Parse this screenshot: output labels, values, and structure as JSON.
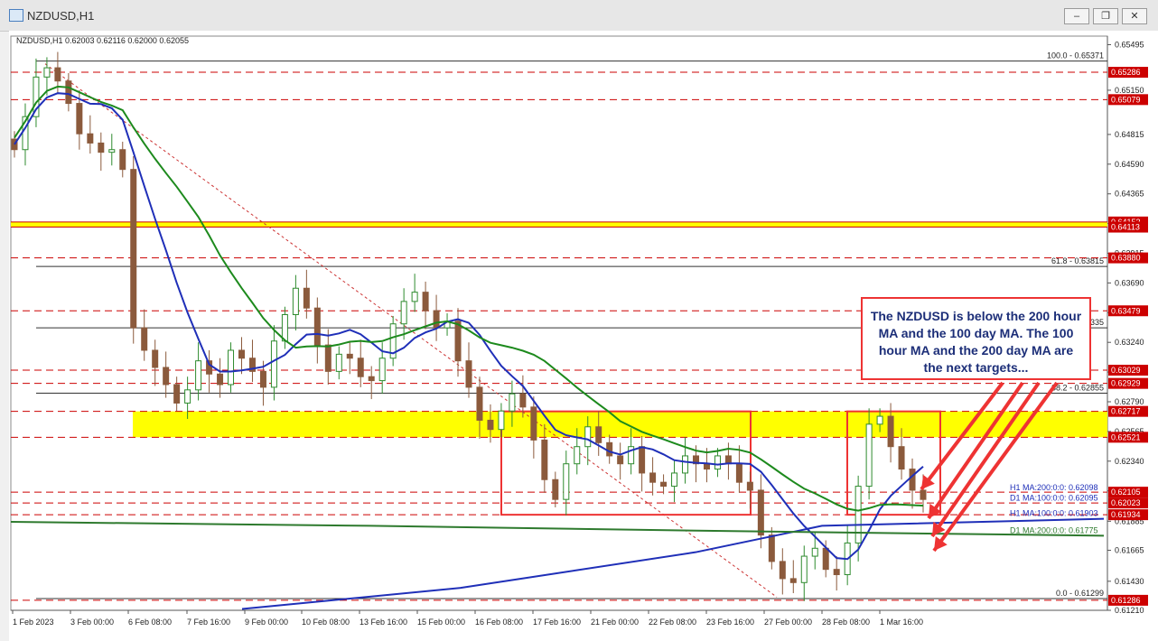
{
  "window": {
    "title": "NZDUSD,H1",
    "min_label": "‒",
    "restore_label": "❐",
    "close_label": "✕"
  },
  "header": {
    "info": "NZDUSD,H1  0.62003 0.62116 0.62000 0.62055"
  },
  "callout": {
    "text": "The NZDUSD is below the 200 hour MA and the 100 day MA. The 100 hour MA and the 200 day MA are the next targets..."
  },
  "colors": {
    "candle_up": "#2e8b2e",
    "candle_down": "#8b5a3c",
    "ma100_hour": "#1f2fb8",
    "ma200_hour": "#1d8a1d",
    "ma100_day": "#2a5a2a",
    "ma200_day": "#2e7a2e",
    "highlight": "#ffff00",
    "arrow": "#ee3333",
    "price_tag": "#cc0000"
  },
  "chart_data": {
    "type": "candlestick",
    "symbol": "NZDUSD",
    "timeframe": "H1",
    "ylim": [
      0.6121,
      0.6556
    ],
    "y_ticks": [
      "0.65495",
      "0.65150",
      "0.64815",
      "0.64590",
      "0.64365",
      "0.64140",
      "0.63915",
      "0.63690",
      "0.63465",
      "0.63240",
      "0.63015",
      "0.62790",
      "0.62565",
      "0.62340",
      "0.62115",
      "0.61885",
      "0.61665",
      "0.61430",
      "0.61210"
    ],
    "x_labels": [
      "1 Feb 2023",
      "3 Feb 00:00",
      "6 Feb 08:00",
      "7 Feb 16:00",
      "9 Feb 00:00",
      "10 Feb 08:00",
      "13 Feb 16:00",
      "15 Feb 00:00",
      "16 Feb 08:00",
      "17 Feb 16:00",
      "21 Feb 00:00",
      "22 Feb 08:00",
      "23 Feb 16:00",
      "27 Feb 00:00",
      "28 Feb 08:00",
      "1 Mar 16:00"
    ],
    "price_levels": [
      {
        "value": 0.65286,
        "label": "0.65286",
        "style": "dashed-red"
      },
      {
        "value": 0.65079,
        "label": "0.65079",
        "style": "dashed-red"
      },
      {
        "value": 0.64152,
        "label": "0.64152",
        "style": "highlight"
      },
      {
        "value": 0.64113,
        "label": "0.64113",
        "style": "highlight"
      },
      {
        "value": 0.6388,
        "label": "0.63880",
        "style": "dashed-red"
      },
      {
        "value": 0.63479,
        "label": "0.63479",
        "style": "dashed-red"
      },
      {
        "value": 0.63029,
        "label": "0.63029",
        "style": "dashed-red"
      },
      {
        "value": 0.62929,
        "label": "0.62929",
        "style": "dashed-red"
      },
      {
        "value": 0.62717,
        "label": "0.62717",
        "style": "dashed-red"
      },
      {
        "value": 0.62521,
        "label": "0.62521",
        "style": "dashed-red"
      },
      {
        "value": 0.62105,
        "label": "0.62105",
        "style": "dashed-red"
      },
      {
        "value": 0.62023,
        "label": "0.62023",
        "style": "dashed-red"
      },
      {
        "value": 0.61934,
        "label": "0.61934",
        "style": "dashed-red"
      },
      {
        "value": 0.61286,
        "label": "0.61286",
        "style": "dashed-red"
      }
    ],
    "fib_levels": [
      {
        "value": 0.65371,
        "label": "100.0 - 0.65371"
      },
      {
        "value": 0.63815,
        "label": "61.8 - 0.63815"
      },
      {
        "value": 0.6335,
        "label": "335"
      },
      {
        "value": 0.62855,
        "label": "38.2 - 0.62855"
      },
      {
        "value": 0.61299,
        "label": "0.0 - 0.61299"
      }
    ],
    "moving_averages": [
      {
        "name": "H1 MA:200:0:0: 0.62098",
        "value": 0.62098
      },
      {
        "name": "H1 MA:100:0:0: 0.61903",
        "value": 0.61903
      },
      {
        "name": "D1 MA:100:0:0: 0.62095",
        "value": 0.62095
      },
      {
        "name": "D1 MA:200:0:0: 0.61775",
        "value": 0.61775
      }
    ],
    "yellow_zone": [
      0.62521,
      0.62717
    ],
    "close_series": [
      0.647,
      0.6495,
      0.6525,
      0.6532,
      0.6522,
      0.6505,
      0.6482,
      0.6475,
      0.6468,
      0.647,
      0.6455,
      0.6335,
      0.6318,
      0.6305,
      0.6292,
      0.6278,
      0.6288,
      0.631,
      0.63,
      0.6292,
      0.6318,
      0.6312,
      0.6302,
      0.629,
      0.6325,
      0.6345,
      0.6365,
      0.635,
      0.6322,
      0.6302,
      0.6315,
      0.6312,
      0.6298,
      0.6295,
      0.6312,
      0.6338,
      0.6355,
      0.6362,
      0.6348,
      0.6335,
      0.634,
      0.631,
      0.629,
      0.6265,
      0.6258,
      0.6272,
      0.6285,
      0.6275,
      0.625,
      0.622,
      0.6205,
      0.6232,
      0.6245,
      0.626,
      0.6248,
      0.6238,
      0.6232,
      0.6245,
      0.6225,
      0.6218,
      0.6215,
      0.6225,
      0.6238,
      0.6232,
      0.6228,
      0.6238,
      0.6232,
      0.6218,
      0.6212,
      0.6178,
      0.6158,
      0.6145,
      0.6142,
      0.6162,
      0.6168,
      0.6152,
      0.6148,
      0.6172,
      0.6215,
      0.6262,
      0.6268,
      0.6245,
      0.6228,
      0.6212,
      0.6205
    ]
  }
}
